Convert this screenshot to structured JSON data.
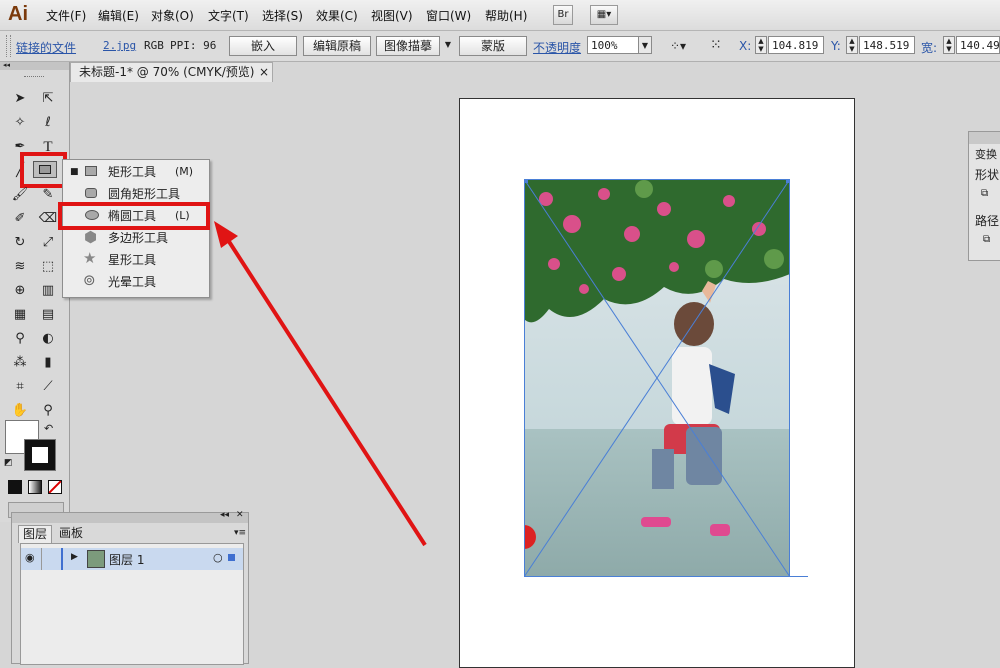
{
  "app": {
    "logo": "Ai"
  },
  "menubar": {
    "items": [
      "文件(F)",
      "编辑(E)",
      "对象(O)",
      "文字(T)",
      "选择(S)",
      "效果(C)",
      "视图(V)",
      "窗口(W)",
      "帮助(H)"
    ],
    "bridge_label": "Br"
  },
  "control_bar": {
    "linked_file": "链接的文件",
    "file_name": "2.jpg",
    "color_mode": "RGB",
    "ppi": "PPI: 96",
    "embed": "嵌入",
    "edit_original": "编辑原稿",
    "image_trace": "图像描摹",
    "mask": "蒙版",
    "opacity_label": "不透明度",
    "opacity_value": "100%",
    "x_label": "X:",
    "x_value": "104.819",
    "y_label": "Y:",
    "y_value": "148.519",
    "w_label": "宽:",
    "w_value": "140.494"
  },
  "document_tab": {
    "title": "未标题-1* @ 70% (CMYK/预览)",
    "close": "×"
  },
  "flyout": {
    "items": [
      {
        "label": "矩形工具",
        "key": "(M)"
      },
      {
        "label": "圆角矩形工具",
        "key": ""
      },
      {
        "label": "椭圆工具",
        "key": "(L)"
      },
      {
        "label": "多边形工具",
        "key": ""
      },
      {
        "label": "星形工具",
        "key": ""
      },
      {
        "label": "光晕工具",
        "key": ""
      }
    ],
    "active_index": 0,
    "highlighted_index": 2
  },
  "right_panel": {
    "title": "变换",
    "row1": "形状",
    "row2": "路径"
  },
  "layers_panel": {
    "tab_layers": "图层",
    "tab_artboards": "画板",
    "layer_name": "图层 1"
  },
  "colors": {
    "highlight_red": "#e01414",
    "selection_blue": "#4a7fd6",
    "panel_gray": "#d9d9d9"
  }
}
